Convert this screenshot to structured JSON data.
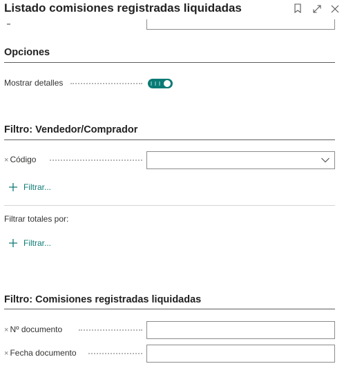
{
  "header": {
    "title": "Listado comisiones registradas liquidadas",
    "bookmark_icon": "bookmark-icon",
    "expand_icon": "expand-icon",
    "close_icon": "close-icon"
  },
  "options": {
    "title": "Opciones",
    "show_details_label": "Mostrar detalles",
    "show_details_value": true
  },
  "salesperson_filter": {
    "title": "Filtro: Vendedor/Comprador",
    "code_label": "Código",
    "code_value": "",
    "add_filter_label": "Filtrar...",
    "totals_label": "Filtrar totales por:",
    "add_totals_filter_label": "Filtrar..."
  },
  "commission_filter": {
    "title": "Filtro: Comisiones registradas liquidadas",
    "doc_no_label": "Nº documento",
    "doc_no_value": "",
    "doc_date_label": "Fecha documento",
    "doc_date_value": ""
  },
  "colors": {
    "accent": "#0b7a75",
    "rule": "#5c5c5c",
    "border": "#8a8a8a"
  },
  "remove_filter_glyph": "×"
}
